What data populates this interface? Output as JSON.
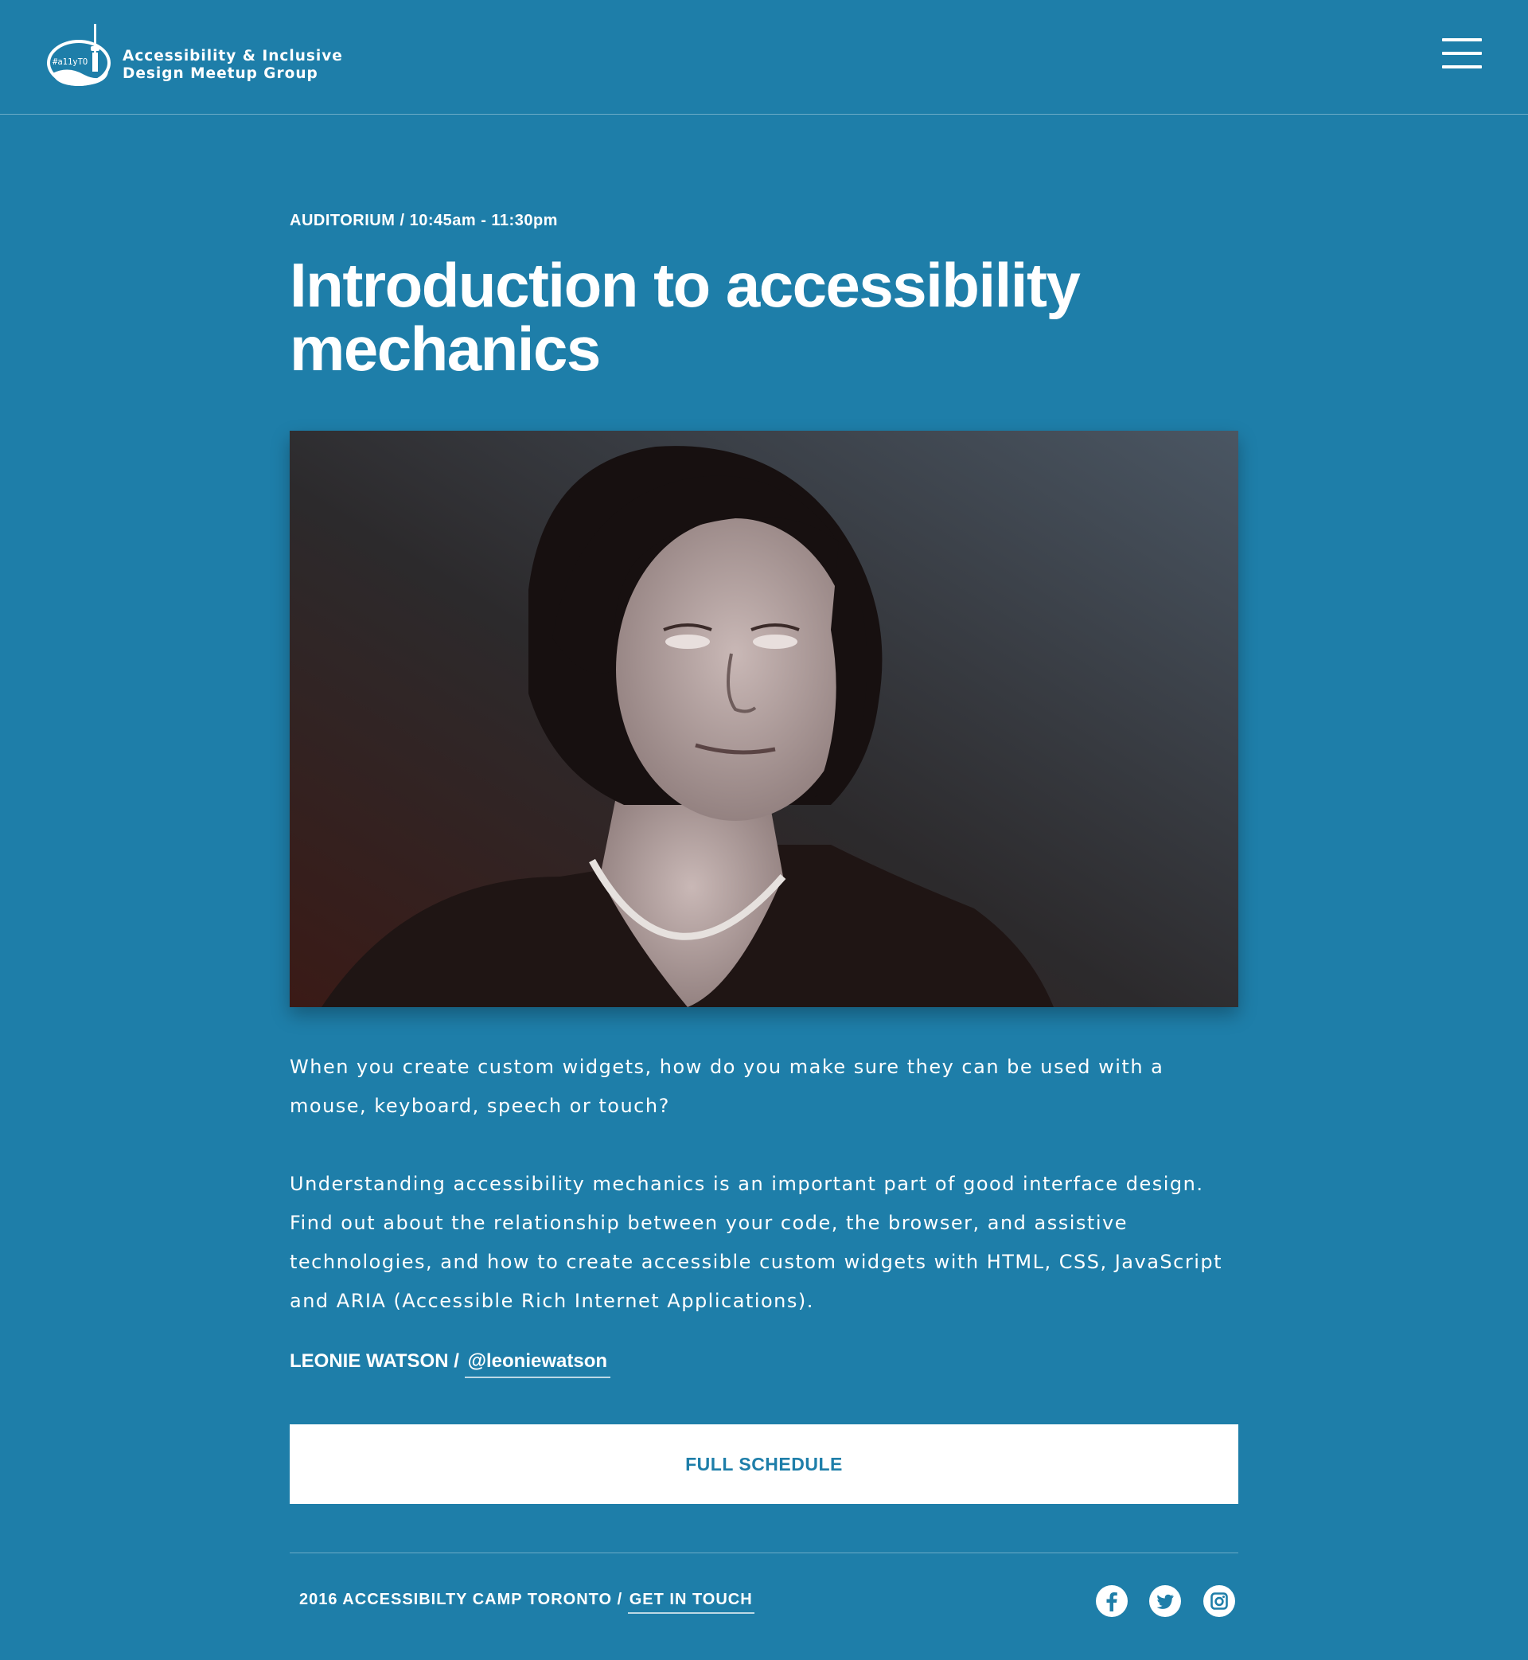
{
  "header": {
    "logo_tag": "#a11yTO",
    "brand_line1": "Accessibility & Inclusive",
    "brand_line2": "Design Meetup Group",
    "menu_icon": "hamburger-menu-icon"
  },
  "session": {
    "location": "AUDITORIUM",
    "time": "10:45am - 11:30pm",
    "title": "Introduction to accessibility mechanics",
    "photo_alt": "Portrait of Leonie Watson",
    "paragraphs": [
      "When you create custom widgets, how do you make sure they can be used with a mouse, keyboard, speech or touch?",
      "Understanding accessibility mechanics is an important part of good interface design. Find out about the relationship between your code, the browser, and assistive technologies, and how to create accessible custom widgets with HTML, CSS, JavaScript and ARIA (Accessible Rich Internet Applications)."
    ],
    "speaker_name": "LEONIE WATSON",
    "speaker_handle": "@leoniewatson"
  },
  "actions": {
    "full_schedule": "FULL SCHEDULE"
  },
  "footer": {
    "event": "2016 ACCESSIBILTY CAMP TORONTO",
    "contact_link": "GET IN TOUCH",
    "social_icons": [
      "facebook-icon",
      "twitter-icon",
      "instagram-icon"
    ]
  },
  "colors": {
    "background": "#1e7ea9",
    "text": "#ffffff",
    "button_text": "#1e7ea9"
  }
}
